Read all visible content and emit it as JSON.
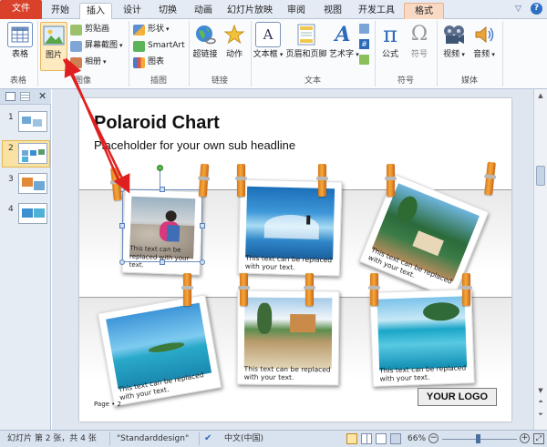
{
  "tabs": [
    {
      "label": "文件"
    },
    {
      "label": "开始"
    },
    {
      "label": "插入"
    },
    {
      "label": "设计"
    },
    {
      "label": "切换"
    },
    {
      "label": "动画"
    },
    {
      "label": "幻灯片放映"
    },
    {
      "label": "审阅"
    },
    {
      "label": "视图"
    },
    {
      "label": "开发工具"
    },
    {
      "label": "格式"
    }
  ],
  "ribbon": {
    "table": {
      "button": "表格",
      "group": "表格"
    },
    "images": {
      "picture": "图片",
      "clipart": "剪贴画",
      "screenshot": "屏幕截图",
      "album": "相册",
      "group": "图像"
    },
    "illustrations": {
      "shapes": "形状",
      "smartart": "SmartArt",
      "chart": "图表",
      "group": "插图"
    },
    "links": {
      "hyperlink": "超链接",
      "action": "动作",
      "group": "链接"
    },
    "text": {
      "textbox": "文本框",
      "header_footer": "页眉和页脚",
      "wordart": "艺术字",
      "group": "文本"
    },
    "symbols": {
      "equation": "公式",
      "symbol": "符号",
      "group": "符号"
    },
    "media": {
      "video": "视频",
      "audio": "音频",
      "group": "媒体"
    }
  },
  "slides_panel": {
    "thumbnails": [
      {
        "number": "1"
      },
      {
        "number": "2"
      },
      {
        "number": "3"
      },
      {
        "number": "4"
      }
    ],
    "active": "2"
  },
  "slide": {
    "title": "Polaroid Chart",
    "subtitle": "Placeholder for your own sub headline",
    "page_label": "Page • 2",
    "logo_text": "YOUR LOGO",
    "captions": [
      "This text can be replaced with your text.",
      "This text can be replaced with your text.",
      "This text can be replaced with your text.",
      "This text can be replaced with your text.",
      "This text can be replaced with your text.",
      "This text can be replaced with your text."
    ]
  },
  "status_bar": {
    "slide_info": "幻灯片 第 2 张，共 4 张",
    "theme": "\"Standarddesign\"",
    "language": "中文(中国)",
    "zoom": "66%"
  },
  "colors": {
    "file_tab": "#d9412a",
    "annotation_arrow": "#e02020",
    "clip": "#f0a030",
    "ribbon_bg": "#fafbfd"
  }
}
